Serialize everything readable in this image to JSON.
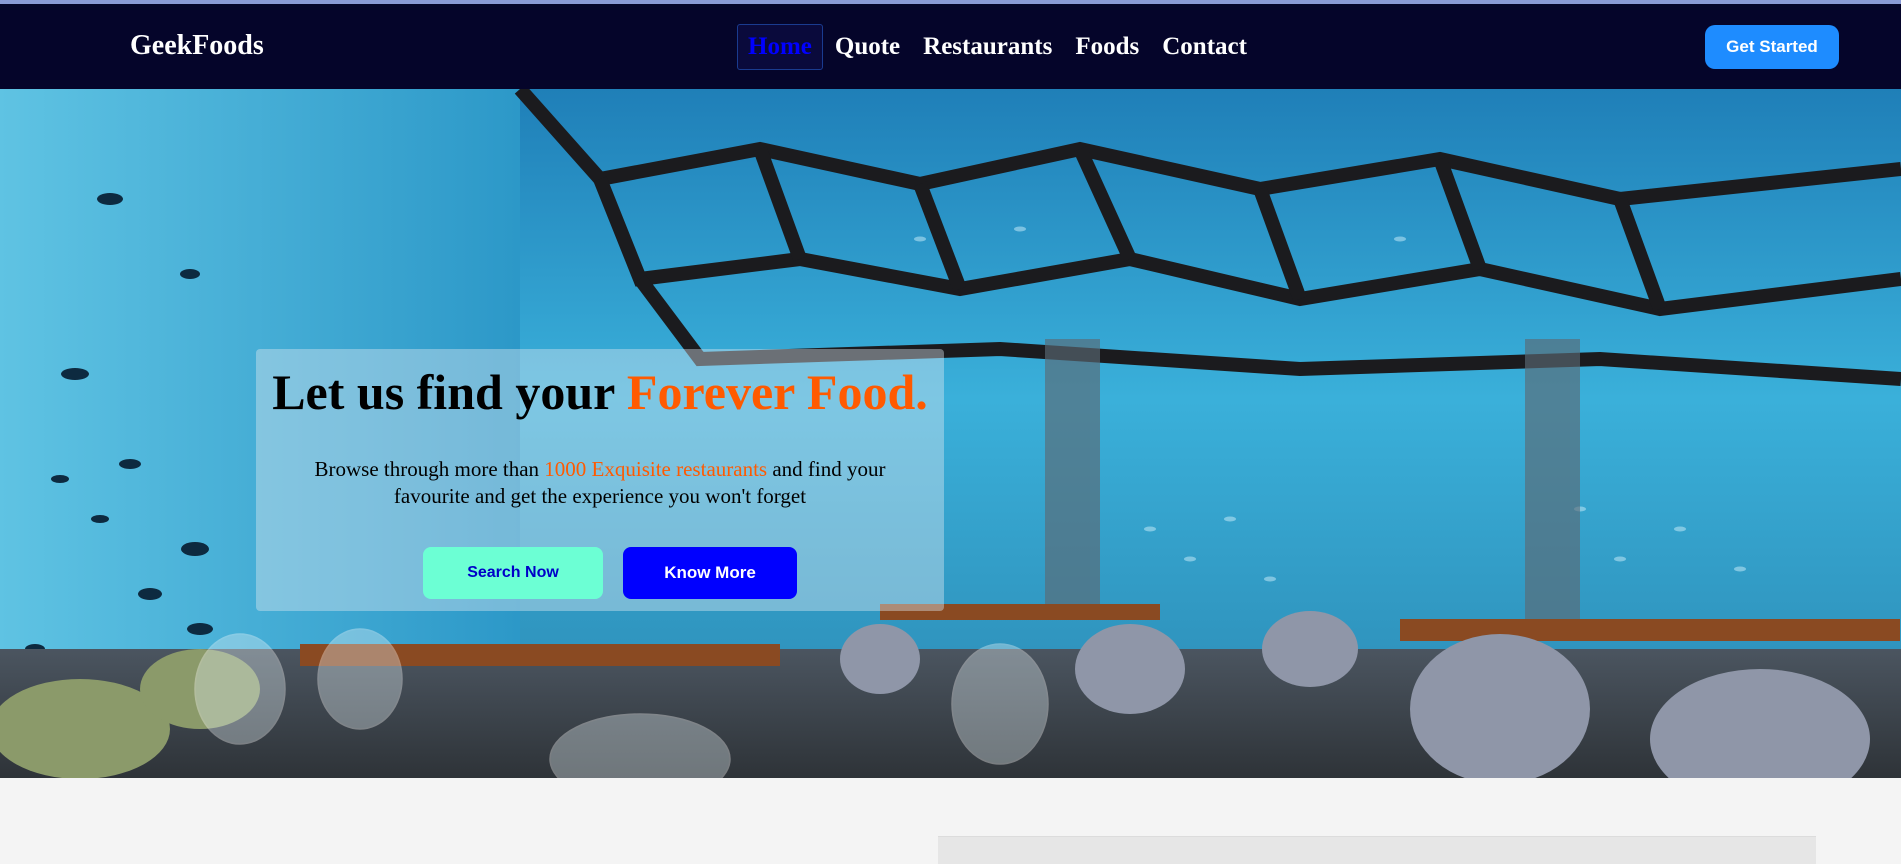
{
  "navbar": {
    "brand": "GeekFoods",
    "links": [
      {
        "label": "Home",
        "active": true
      },
      {
        "label": "Quote",
        "active": false
      },
      {
        "label": "Restaurants",
        "active": false
      },
      {
        "label": "Foods",
        "active": false
      },
      {
        "label": "Contact",
        "active": false
      }
    ],
    "cta_label": "Get Started"
  },
  "hero": {
    "title_prefix": "Let us find your ",
    "title_accent": "Forever Food.",
    "subtitle_prefix": "Browse through more than ",
    "subtitle_accent": "1000 Exquisite restaurants",
    "subtitle_suffix": " and find your favourite and get the experience you won't forget",
    "primary_button": "Search Now",
    "secondary_button": "Know More"
  },
  "colors": {
    "nav_background": "#05052a",
    "accent_orange": "#ff5a00",
    "cta_blue": "#1e8cff",
    "search_button": "#6cffd4",
    "know_more_button": "#0000ff"
  },
  "icons": {
    "background": "underwater-restaurant-photo"
  }
}
